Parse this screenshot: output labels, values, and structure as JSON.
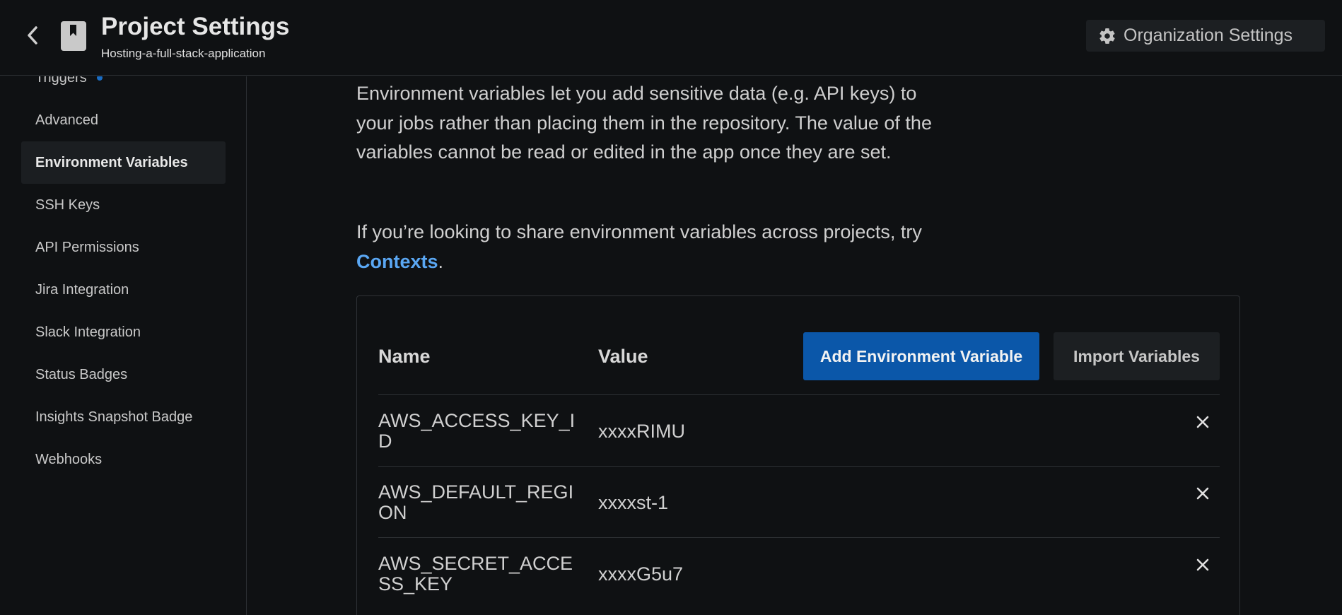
{
  "header": {
    "title": "Project Settings",
    "project_name": "Hosting-a-full-stack-application",
    "org_settings_label": "Organization Settings"
  },
  "sidebar": {
    "items": [
      {
        "label": "Triggers",
        "has_dot": true
      },
      {
        "label": "Advanced"
      },
      {
        "label": "Environment Variables",
        "active": true
      },
      {
        "label": "SSH Keys"
      },
      {
        "label": "API Permissions"
      },
      {
        "label": "Jira Integration"
      },
      {
        "label": "Slack Integration"
      },
      {
        "label": "Status Badges"
      },
      {
        "label": "Insights Snapshot Badge"
      },
      {
        "label": "Webhooks"
      }
    ]
  },
  "main": {
    "intro": "Environment variables let you add sensitive data (e.g. API keys) to your jobs rather than placing them in the repository. The value of the variables cannot be read or edited in the app once they are set.",
    "share_text": "If you’re looking to share environment variables across projects, try ",
    "share_link": "Contexts",
    "share_end": "."
  },
  "table": {
    "name_header": "Name",
    "value_header": "Value",
    "add_button": "Add Environment Variable",
    "import_button": "Import Variables",
    "rows": [
      {
        "name": "AWS_ACCESS_KEY_ID",
        "value": "xxxxRIMU"
      },
      {
        "name": "AWS_DEFAULT_REGION",
        "value": "xxxxst-1"
      },
      {
        "name": "AWS_SECRET_ACCESS_KEY",
        "value": "xxxxG5u7"
      }
    ]
  },
  "colors": {
    "accent": "#0b57a9",
    "link": "#5aa7f3",
    "background": "#0f1113"
  }
}
